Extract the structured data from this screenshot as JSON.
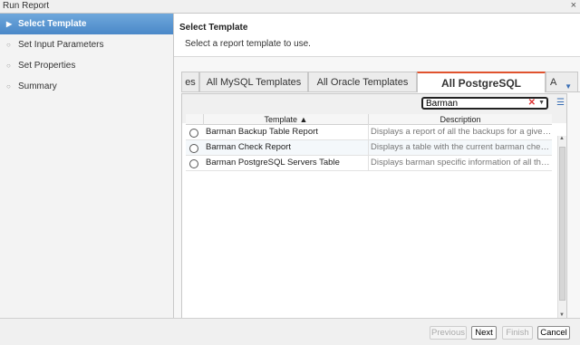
{
  "window": {
    "title": "Run Report",
    "close_glyph": "×"
  },
  "sidebar": {
    "items": [
      {
        "label": "Select Template",
        "active": true
      },
      {
        "label": "Set Input Parameters",
        "active": false
      },
      {
        "label": "Set Properties",
        "active": false
      },
      {
        "label": "Summary",
        "active": false
      }
    ]
  },
  "header": {
    "title": "Select Template",
    "subtitle": "Select a report template to use."
  },
  "tabs": [
    {
      "label": "es"
    },
    {
      "label": "All MySQL Templates"
    },
    {
      "label": "All Oracle Templates"
    },
    {
      "label": "All PostgreSQL Template",
      "selected": true
    },
    {
      "label": "A"
    }
  ],
  "search": {
    "value": "Barman",
    "clear_icon": "clear-icon",
    "dropdown_icon": "chevron-down-icon"
  },
  "grid": {
    "columns": [
      "Template ▲",
      "Description"
    ],
    "rows": [
      {
        "template": "Barman Backup Table Report",
        "description": "Displays a report of all the backups for a given Pos..."
      },
      {
        "template": "Barman Check Report",
        "description": "Displays a table with the current barman check co..."
      },
      {
        "template": "Barman PostgreSQL Servers Table",
        "description": "Displays barman specific information of all the Post..."
      }
    ]
  },
  "footer": {
    "previous": "Previous",
    "next": "Next",
    "finish": "Finish",
    "cancel": "Cancel"
  },
  "colors": {
    "accent": "#4a88c8",
    "tab_highlight": "#e0532e"
  }
}
